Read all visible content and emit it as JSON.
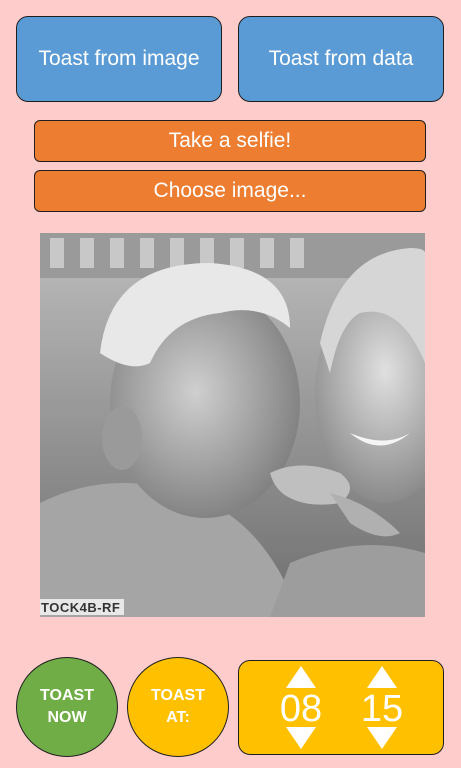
{
  "buttons": {
    "toast_from_image": "Toast from image",
    "toast_from_data": "Toast from data",
    "take_selfie": "Take a selfie!",
    "choose_image": "Choose image..."
  },
  "photo": {
    "watermark": "TOCK4B-RF"
  },
  "controls": {
    "toast_now": [
      "TOAST",
      "NOW"
    ],
    "toast_at": [
      "TOAST",
      "AT:"
    ],
    "hour": "08",
    "minute": "15"
  },
  "colors": {
    "background": "#ffcccc",
    "blue": "#5b9bd5",
    "orange": "#ed7d31",
    "green": "#70ad47",
    "gold": "#ffc000"
  }
}
